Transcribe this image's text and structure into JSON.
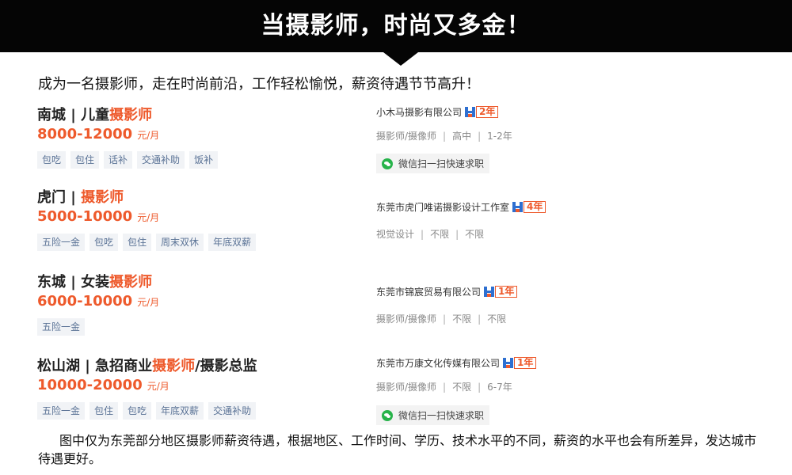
{
  "header": {
    "title": "当摄影师，时尚又多金！"
  },
  "intro": "成为一名摄影师，走在时尚前沿，工作轻松愉悦，薪资待遇节节高升！",
  "jobs": [
    {
      "location": "南城",
      "separator": " | ",
      "title_prefix": "儿童",
      "keyword": "摄影师",
      "title_suffix": "",
      "salary": "8000-12000",
      "salary_unit": "元/月",
      "tags": [
        "包吃",
        "包住",
        "话补",
        "交通补助",
        "饭补"
      ],
      "company": "小木马摄影有限公司",
      "years": "2年",
      "details": [
        "摄影师/摄像师",
        "高中",
        "1-2年"
      ],
      "wechat": "微信扫一扫快速求职"
    },
    {
      "location": "虎门",
      "separator": " | ",
      "title_prefix": "",
      "keyword": "摄影师",
      "title_suffix": "",
      "salary": "5000-10000",
      "salary_unit": "元/月",
      "tags": [
        "五险一金",
        "包吃",
        "包住",
        "周末双休",
        "年底双薪"
      ],
      "company": "东莞市虎门唯诺摄影设计工作室",
      "years": "4年",
      "details": [
        "视觉设计",
        "不限",
        "不限"
      ],
      "wechat": ""
    },
    {
      "location": "东城",
      "separator": " | ",
      "title_prefix": "女装",
      "keyword": "摄影师",
      "title_suffix": "",
      "salary": "6000-10000",
      "salary_unit": "元/月",
      "tags": [
        "五险一金"
      ],
      "company": "东莞市锦宸贸易有限公司",
      "years": "1年",
      "details": [
        "摄影师/摄像师",
        "不限",
        "不限"
      ],
      "wechat": ""
    },
    {
      "location": "松山湖",
      "separator": " | ",
      "title_prefix": "急招商业",
      "keyword": "摄影师",
      "title_suffix": "/摄影总监",
      "salary": "10000-20000",
      "salary_unit": "元/月",
      "tags": [
        "五险一金",
        "包住",
        "包吃",
        "年底双薪",
        "交通补助"
      ],
      "company": "东莞市万康文化传媒有限公司",
      "years": "1年",
      "details": [
        "摄影师/摄像师",
        "不限",
        "6-7年"
      ],
      "wechat": "微信扫一扫快速求职"
    }
  ],
  "footer": "图中仅为东莞部分地区摄影师薪资待遇，根据地区、工作时间、学历、技术水平的不同，薪资的水平也会有所差异，发达城市待遇更好。",
  "colors": {
    "accent": "#ee5a2c",
    "banner": "#050505",
    "tag_text": "#5b7396",
    "wechat_green": "#27b34a",
    "cert_blue": "#2e6fd0"
  },
  "icons": {
    "certification": "certified-years-icon",
    "wechat": "wechat-icon"
  }
}
